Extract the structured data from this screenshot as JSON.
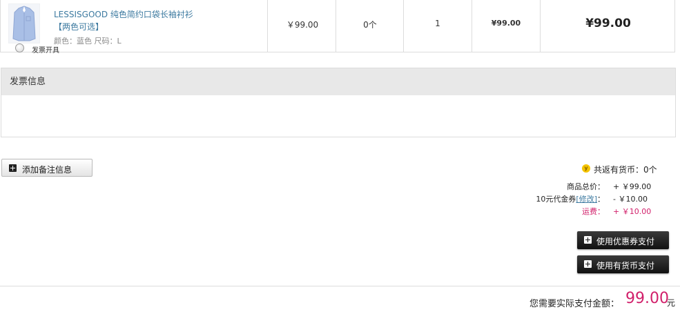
{
  "product": {
    "name": "LESSISGOOD 纯色简约口袋长袖衬衫【两色可选】",
    "attributes": "颜色：蓝色 尺码：L",
    "unit_price": "￥99.00",
    "coins": "0个",
    "quantity": "1",
    "subtotal": "¥99.00",
    "total": "¥99.00"
  },
  "invoice": {
    "title": "发票信息",
    "option_label": "发票开具"
  },
  "note_button": "添加备注信息",
  "summary": {
    "coin_icon": "y",
    "coin_return": "共返有货币：0个",
    "goods_total_label": "商品总价：",
    "goods_total_value": "+ ￥99.00",
    "voucher_label": "10元代金券",
    "voucher_edit": "[修改]",
    "voucher_colon": "：",
    "voucher_value": "- ￥10.00",
    "shipping_label": "运费：",
    "shipping_value": "+ ￥10.00"
  },
  "buttons": {
    "coupon": "使用优惠券支付",
    "coin": "使用有货币支付"
  },
  "payment": {
    "label": "您需要实际支付金额：",
    "amount": "99.00",
    "unit": "元"
  },
  "colors": {
    "link": "#3d7aa0",
    "accent": "#d11f6a"
  }
}
